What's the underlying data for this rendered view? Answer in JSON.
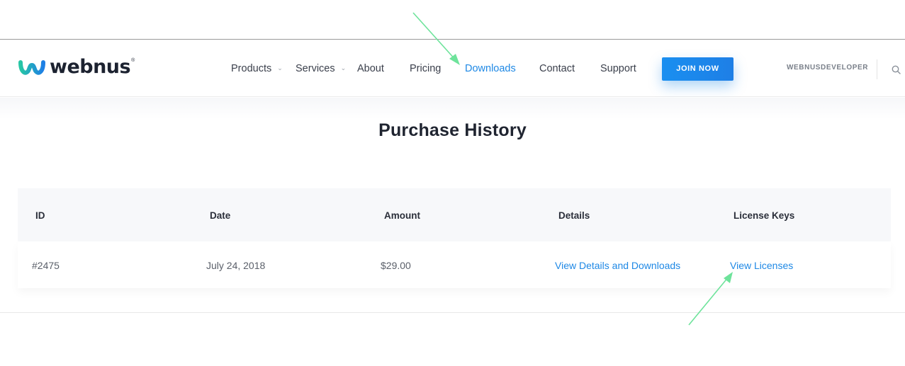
{
  "brand": {
    "name": "webnus",
    "reg_mark": "®",
    "accent_color": "#1e88e5"
  },
  "nav": {
    "items": [
      {
        "label": "Products",
        "has_dropdown": true
      },
      {
        "label": "Services",
        "has_dropdown": true
      },
      {
        "label": "About",
        "has_dropdown": false
      },
      {
        "label": "Pricing",
        "has_dropdown": false
      },
      {
        "label": "Downloads",
        "has_dropdown": false,
        "active": true
      },
      {
        "label": "Contact",
        "has_dropdown": false
      },
      {
        "label": "Support",
        "has_dropdown": false
      }
    ],
    "join_label": "JOIN NOW",
    "username": "WEBNUSDEVELOPER",
    "search_icon": "search-icon"
  },
  "page": {
    "title": "Purchase History"
  },
  "table": {
    "headers": [
      "ID",
      "Date",
      "Amount",
      "Details",
      "License Keys"
    ],
    "rows": [
      {
        "id": "#2475",
        "date": "July 24, 2018",
        "amount": "$29.00",
        "details_link": "View Details and Downloads",
        "license_link": "View Licenses"
      }
    ]
  },
  "annotations": {
    "arrow_color": "#6ee39b"
  }
}
